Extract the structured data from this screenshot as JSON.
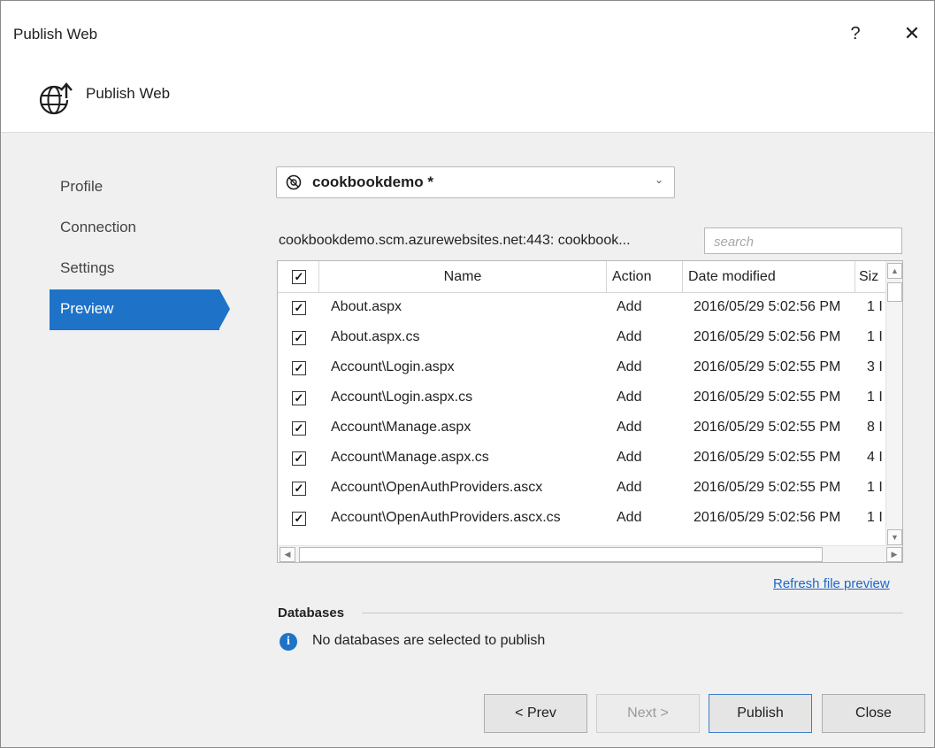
{
  "window": {
    "title": "Publish Web",
    "help_glyph": "?",
    "close_glyph": "✕"
  },
  "header": {
    "title": "Publish Web",
    "icon": "globe-upload-icon"
  },
  "nav": {
    "items": [
      {
        "label": "Profile",
        "active": false
      },
      {
        "label": "Connection",
        "active": false
      },
      {
        "label": "Settings",
        "active": false
      },
      {
        "label": "Preview",
        "active": true
      }
    ]
  },
  "profile": {
    "name": "cookbookdemo *",
    "icon": "azure-icon"
  },
  "connection": {
    "text": "cookbookdemo.scm.azurewebsites.net:443: cookbook..."
  },
  "search": {
    "placeholder": "search",
    "value": ""
  },
  "grid": {
    "columns": [
      "Name",
      "Action",
      "Date modified",
      "Siz"
    ],
    "header_checked": true,
    "rows": [
      {
        "checked": true,
        "name": "About.aspx",
        "action": "Add",
        "date": "2016/05/29 5:02:56 PM",
        "size": "1 I"
      },
      {
        "checked": true,
        "name": "About.aspx.cs",
        "action": "Add",
        "date": "2016/05/29 5:02:56 PM",
        "size": "1 I"
      },
      {
        "checked": true,
        "name": "Account\\Login.aspx",
        "action": "Add",
        "date": "2016/05/29 5:02:55 PM",
        "size": "3 I"
      },
      {
        "checked": true,
        "name": "Account\\Login.aspx.cs",
        "action": "Add",
        "date": "2016/05/29 5:02:55 PM",
        "size": "1 I"
      },
      {
        "checked": true,
        "name": "Account\\Manage.aspx",
        "action": "Add",
        "date": "2016/05/29 5:02:55 PM",
        "size": "8 I"
      },
      {
        "checked": true,
        "name": "Account\\Manage.aspx.cs",
        "action": "Add",
        "date": "2016/05/29 5:02:55 PM",
        "size": "4 I"
      },
      {
        "checked": true,
        "name": "Account\\OpenAuthProviders.ascx",
        "action": "Add",
        "date": "2016/05/29 5:02:55 PM",
        "size": "1 I"
      },
      {
        "checked": true,
        "name": "Account\\OpenAuthProviders.ascx.cs",
        "action": "Add",
        "date": "2016/05/29 5:02:56 PM",
        "size": "1 I"
      }
    ]
  },
  "refresh_link": "Refresh file preview",
  "databases": {
    "title": "Databases",
    "message": "No databases are selected to publish"
  },
  "buttons": {
    "prev": "< Prev",
    "next": "Next >",
    "publish": "Publish",
    "close": "Close"
  },
  "colors": {
    "accent": "#1e73c8",
    "link": "#1e66c8",
    "background": "#f0f0f0"
  }
}
